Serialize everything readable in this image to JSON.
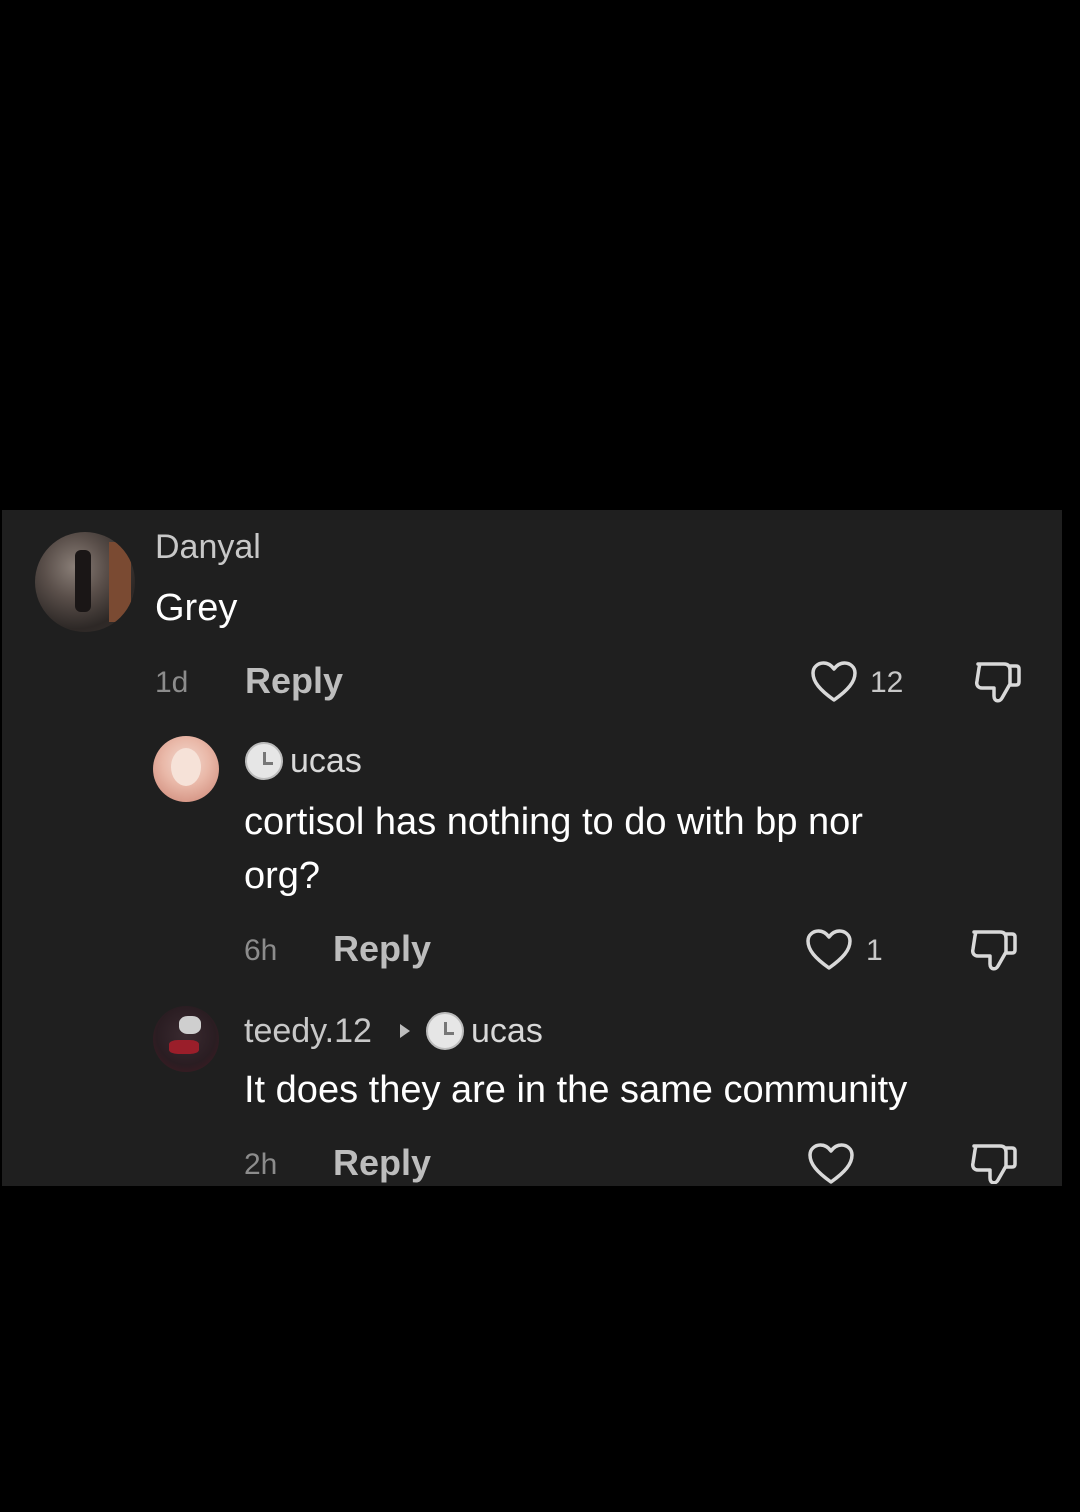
{
  "comments": [
    {
      "username": "Danyal",
      "text": "Grey",
      "time": "1d",
      "reply_label": "Reply",
      "likes": "12"
    },
    {
      "username": "ucas",
      "text_line1": "cortisol has nothing to do with bp nor",
      "text_line2": "org?",
      "time": "6h",
      "reply_label": "Reply",
      "likes": "1"
    },
    {
      "username": "teedy.12",
      "reply_to": "ucas",
      "text": "It does they are in the same community",
      "time": "2h",
      "reply_label": "Reply",
      "likes": ""
    }
  ],
  "colors": {
    "page_background": "#000000",
    "panel_background": "#1f1f1f",
    "text_primary": "#ffffff",
    "text_secondary": "#8c8c8c"
  },
  "icons": [
    "heart-icon",
    "dislike-icon",
    "clock-icon",
    "caret-right-icon"
  ]
}
